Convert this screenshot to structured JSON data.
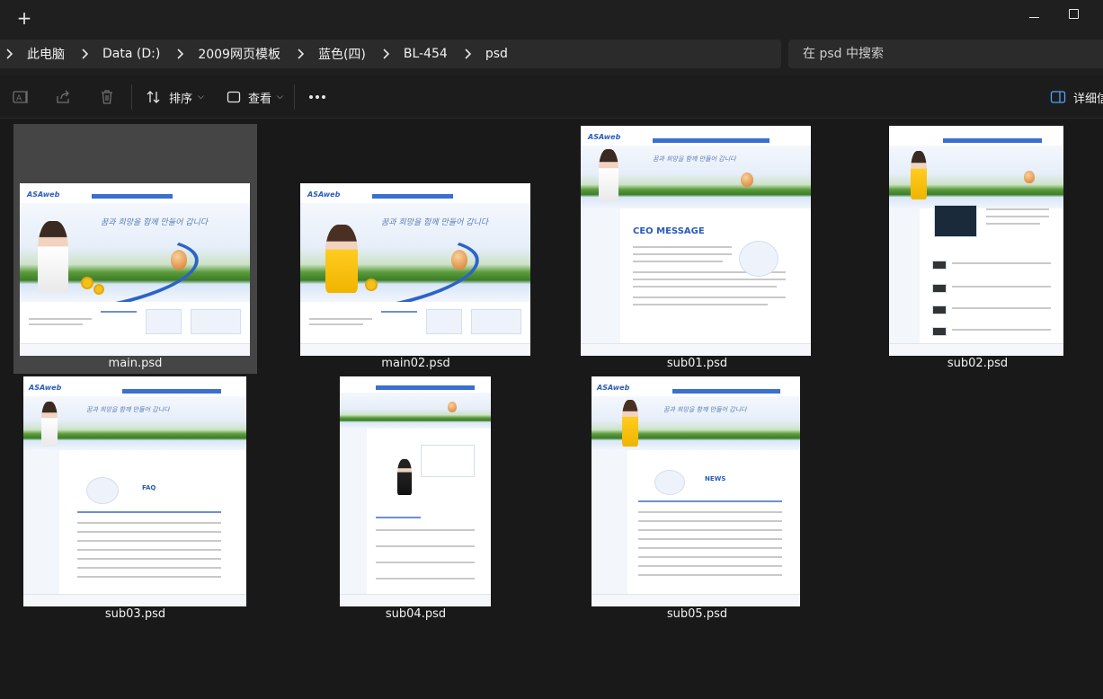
{
  "titlebar": {
    "new_tab_symbol": "+"
  },
  "breadcrumb": {
    "items": [
      "此电脑",
      "Data (D:)",
      "2009网页模板",
      "蓝色(四)",
      "BL-454",
      "psd"
    ]
  },
  "search": {
    "placeholder": "在 psd 中搜索"
  },
  "toolbar": {
    "sort_label": "排序",
    "view_label": "查看",
    "details_label": "详细信"
  },
  "icons": {
    "rename": "rename-icon",
    "share": "share-icon",
    "delete": "delete-icon",
    "sort": "sort-icon",
    "view": "view-icon",
    "more": "more-icon",
    "details": "details-pane-icon"
  },
  "colors": {
    "background": "#191919",
    "selected_tile": "#454545",
    "accent_blue": "#2b63c9"
  },
  "thumbnail_text": {
    "logo": "ASAweb",
    "slogan": "꿈과 희망을 함께 만들어 갑니다",
    "ceo_heading": "CEO MESSAGE",
    "faq_heading": "FAQ",
    "news_heading": "NEWS"
  },
  "files": [
    {
      "name": "main.psd",
      "selected": true
    },
    {
      "name": "main02.psd",
      "selected": false
    },
    {
      "name": "sub01.psd",
      "selected": false
    },
    {
      "name": "sub02.psd",
      "selected": false
    },
    {
      "name": "sub03.psd",
      "selected": false
    },
    {
      "name": "sub04.psd",
      "selected": false
    },
    {
      "name": "sub05.psd",
      "selected": false
    }
  ]
}
